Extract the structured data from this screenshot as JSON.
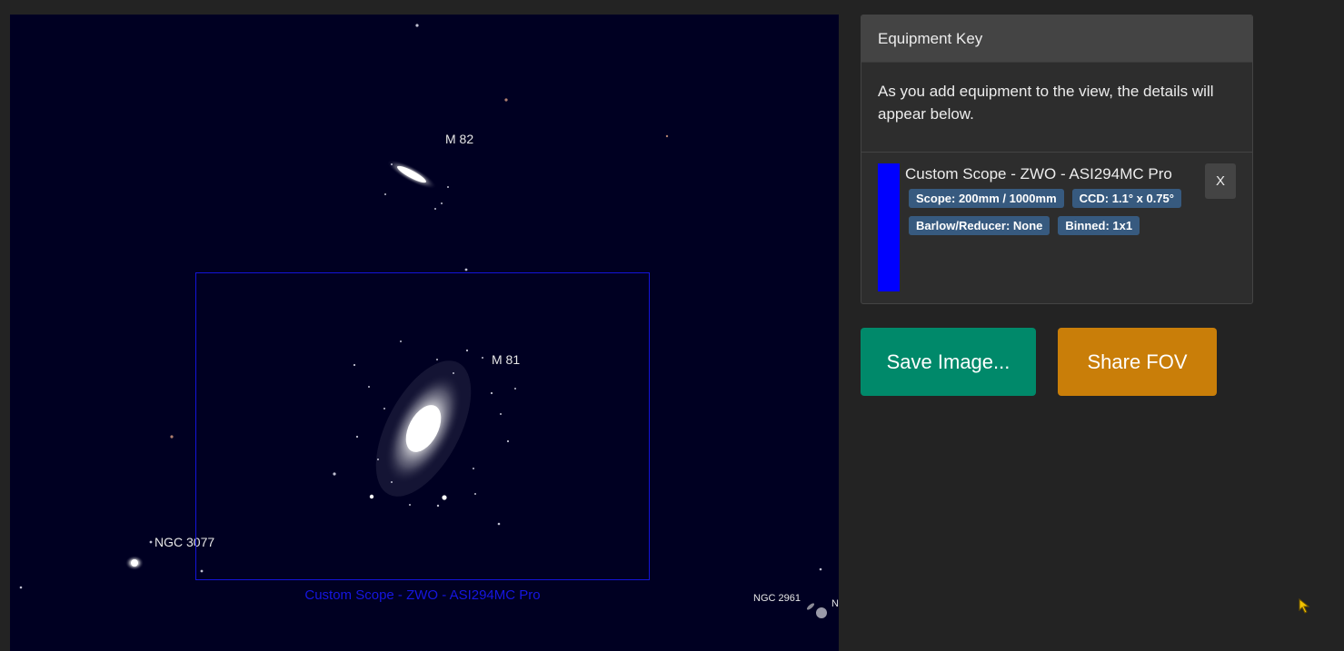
{
  "sky_view": {
    "objects": [
      {
        "name": "M 82"
      },
      {
        "name": "M 81"
      },
      {
        "name": "NGC 3077"
      },
      {
        "name": "NGC 2961"
      },
      {
        "name": "N"
      }
    ],
    "fov_label": "Custom Scope - ZWO - ASI294MC Pro",
    "fov_color": "#1414d8",
    "background_color": "#000022"
  },
  "equipment_key": {
    "title": "Equipment Key",
    "intro": "As you add equipment to the view, the details will appear below.",
    "items": [
      {
        "name": "Custom Scope - ZWO - ASI294MC Pro",
        "color": "#0000ff",
        "badges": [
          "Scope: 200mm / 1000mm",
          "CCD: 1.1° x 0.75°",
          "Barlow/Reducer: None",
          "Binned: 1x1"
        ],
        "remove_label": "X"
      }
    ]
  },
  "actions": {
    "save_label": "Save Image...",
    "share_label": "Share FOV",
    "save_color": "#00896a",
    "share_color": "#c97e09"
  }
}
